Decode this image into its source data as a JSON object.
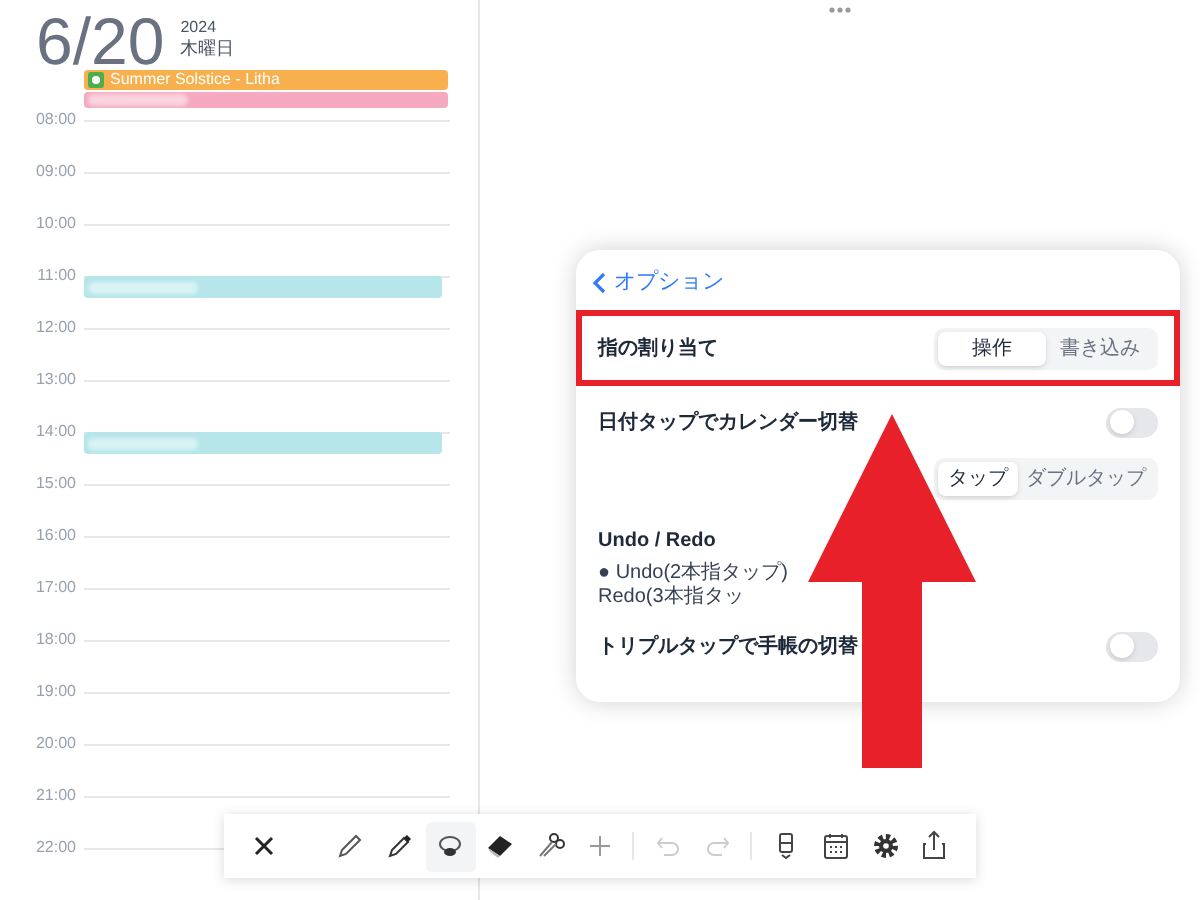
{
  "date": {
    "day": "6/20",
    "year": "2024",
    "weekday": "木曜日"
  },
  "all_day_events": [
    {
      "title": "Summer Solstice - Litha",
      "color": "#f8b04e",
      "icon": true
    },
    {
      "color": "#f5a9c0",
      "icon": false
    }
  ],
  "hours": [
    {
      "label": "08:00"
    },
    {
      "label": "09:00"
    },
    {
      "label": "10:00"
    },
    {
      "label": "11:00",
      "events": [
        {
          "color": "#b6e6ea"
        }
      ]
    },
    {
      "label": "12:00"
    },
    {
      "label": "13:00"
    },
    {
      "label": "14:00",
      "events": [
        {
          "color": "#b6e6ea"
        }
      ]
    },
    {
      "label": "15:00"
    },
    {
      "label": "16:00"
    },
    {
      "label": "17:00"
    },
    {
      "label": "18:00"
    },
    {
      "label": "19:00"
    },
    {
      "label": "20:00"
    },
    {
      "label": "21:00"
    },
    {
      "label": "22:00"
    }
  ],
  "options_popover": {
    "back_label": "オプション",
    "rows": [
      {
        "kind": "segmented",
        "label": "指の割り当て",
        "highlighted": true,
        "segments": [
          {
            "label": "操作",
            "selected": true
          },
          {
            "label": "書き込み",
            "selected": false
          }
        ]
      },
      {
        "kind": "toggle",
        "label": "日付タップでカレンダー切替",
        "on": false
      },
      {
        "kind": "segments_only",
        "segments": [
          {
            "label": "タップ",
            "selected": true
          },
          {
            "label": "ダブルタップ",
            "selected": false
          }
        ]
      },
      {
        "kind": "heading",
        "label": "Undo / Redo",
        "note": "● Undo(2本指タップ) Redo(3本指タッ"
      },
      {
        "kind": "toggle",
        "label": "トリプルタップで手帳の切替",
        "on": false
      }
    ]
  },
  "annotation": {
    "kind": "arrow"
  },
  "toolbar": [
    {
      "kind": "close",
      "selected": false
    },
    {
      "kind": "spacer"
    },
    {
      "kind": "pencil",
      "selected": false
    },
    {
      "kind": "marker",
      "selected": false
    },
    {
      "kind": "lasso",
      "selected": true
    },
    {
      "kind": "eraser",
      "selected": false
    },
    {
      "kind": "scissors",
      "selected": false
    },
    {
      "kind": "plus",
      "selected": false
    },
    {
      "kind": "divider"
    },
    {
      "kind": "undo",
      "selected": false
    },
    {
      "kind": "redo",
      "selected": false
    },
    {
      "kind": "divider"
    },
    {
      "kind": "page",
      "selected": false
    },
    {
      "kind": "calendar",
      "selected": false
    },
    {
      "kind": "gear",
      "selected": false
    },
    {
      "kind": "share",
      "selected": false
    }
  ]
}
